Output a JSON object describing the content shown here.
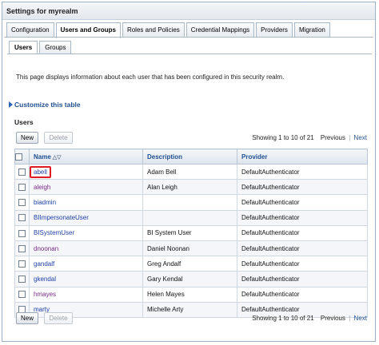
{
  "panel_title": "Settings for myrealm",
  "tabs": [
    {
      "label": "Configuration",
      "active": false
    },
    {
      "label": "Users and Groups",
      "active": true
    },
    {
      "label": "Roles and Policies",
      "active": false
    },
    {
      "label": "Credential Mappings",
      "active": false
    },
    {
      "label": "Providers",
      "active": false
    },
    {
      "label": "Migration",
      "active": false
    }
  ],
  "subtabs": [
    {
      "label": "Users",
      "active": true
    },
    {
      "label": "Groups",
      "active": false
    }
  ],
  "description": "This page displays information about each user that has been configured in this security realm.",
  "customize_label": "Customize this table",
  "section_title": "Users",
  "buttons": {
    "new": "New",
    "delete": "Delete"
  },
  "paging": {
    "showing": "Showing 1 to 10 of 21",
    "previous": "Previous",
    "next": "Next"
  },
  "table": {
    "headers": {
      "name": "Name",
      "description": "Description",
      "provider": "Provider"
    },
    "rows": [
      {
        "name": "abell",
        "description": "Adam Bell",
        "provider": "DefaultAuthenticator",
        "visited": false,
        "highlighted": true
      },
      {
        "name": "aleigh",
        "description": "Alan Leigh",
        "provider": "DefaultAuthenticator",
        "visited": true,
        "highlighted": false
      },
      {
        "name": "biadmin",
        "description": "",
        "provider": "DefaultAuthenticator",
        "visited": false,
        "highlighted": false
      },
      {
        "name": "BIImpersonateUser",
        "description": "",
        "provider": "DefaultAuthenticator",
        "visited": false,
        "highlighted": false
      },
      {
        "name": "BISystemUser",
        "description": "BI System User",
        "provider": "DefaultAuthenticator",
        "visited": false,
        "highlighted": false
      },
      {
        "name": "dnoonan",
        "description": "Daniel Noonan",
        "provider": "DefaultAuthenticator",
        "visited": true,
        "highlighted": false
      },
      {
        "name": "gandalf",
        "description": "Greg Andalf",
        "provider": "DefaultAuthenticator",
        "visited": false,
        "highlighted": false
      },
      {
        "name": "gkendal",
        "description": "Gary Kendal",
        "provider": "DefaultAuthenticator",
        "visited": false,
        "highlighted": false
      },
      {
        "name": "hmayes",
        "description": "Helen Mayes",
        "provider": "DefaultAuthenticator",
        "visited": true,
        "highlighted": false
      },
      {
        "name": "marty",
        "description": "Michelle Arty",
        "provider": "DefaultAuthenticator",
        "visited": false,
        "highlighted": false
      }
    ]
  },
  "colors": {
    "link": "#1f3fa6",
    "visited_link": "#7a2a8a",
    "highlight": "#e01b24",
    "header_text": "#1f4f8f"
  }
}
